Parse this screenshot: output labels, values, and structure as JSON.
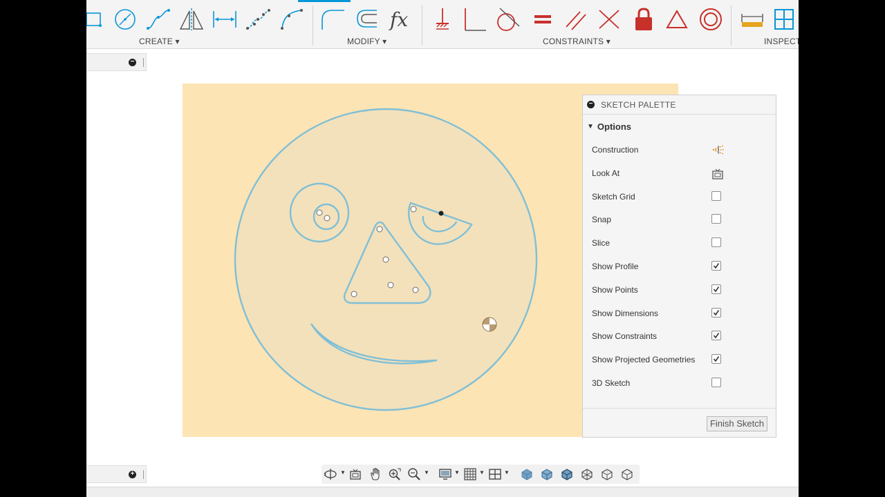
{
  "toolbar": {
    "groups": {
      "create": "CREATE ▾",
      "modify": "MODIFY ▾",
      "constraints": "CONSTRAINTS ▾",
      "inspect": "INSPECT"
    },
    "accent_color": "#0696d7",
    "constraint_color": "#c8302a",
    "tools": {
      "create": [
        "rectangle-icon",
        "circle-icon",
        "spline-icon",
        "mirror-icon",
        "dimension-icon",
        "point-spline-icon",
        "conic-icon"
      ],
      "modify": [
        "fillet-icon",
        "offset-icon",
        "fx-parameters-icon"
      ],
      "constraints": [
        "fix-icon",
        "perpendicular-icon",
        "tangent-icon",
        "equal-icon",
        "parallel-icon",
        "coincident-icon",
        "lock-icon",
        "triangle-icon",
        "concentric-icon"
      ],
      "inspect": [
        "measure-icon",
        "section-icon"
      ]
    }
  },
  "sketch_palette": {
    "title": "SKETCH PALETTE",
    "section": "Options",
    "options": [
      {
        "label": "Construction",
        "control": "icon",
        "icon": "construction-icon"
      },
      {
        "label": "Look At",
        "control": "icon",
        "icon": "look-at-icon"
      },
      {
        "label": "Sketch Grid",
        "control": "checkbox",
        "checked": false
      },
      {
        "label": "Snap",
        "control": "checkbox",
        "checked": false
      },
      {
        "label": "Slice",
        "control": "checkbox",
        "checked": false
      },
      {
        "label": "Show Profile",
        "control": "checkbox",
        "checked": true
      },
      {
        "label": "Show Points",
        "control": "checkbox",
        "checked": true
      },
      {
        "label": "Show Dimensions",
        "control": "checkbox",
        "checked": true
      },
      {
        "label": "Show Constraints",
        "control": "checkbox",
        "checked": true
      },
      {
        "label": "Show Projected Geometries",
        "control": "checkbox",
        "checked": true
      },
      {
        "label": "3D Sketch",
        "control": "checkbox",
        "checked": false
      }
    ],
    "finish_button": "Finish Sketch"
  },
  "canvas": {
    "background": "#fde4b4",
    "sketch_line_color": "#7fbfd6"
  },
  "navbar": {
    "icons": [
      "orbit-icon",
      "look-at-nav-icon",
      "pan-icon",
      "zoom-window-icon",
      "zoom-icon",
      "display-settings-icon",
      "grid-settings-icon",
      "viewports-icon",
      "view-cube-1-icon",
      "view-cube-2-icon",
      "view-cube-3-icon",
      "view-cube-4-icon",
      "view-cube-5-icon",
      "view-cube-6-icon"
    ]
  }
}
